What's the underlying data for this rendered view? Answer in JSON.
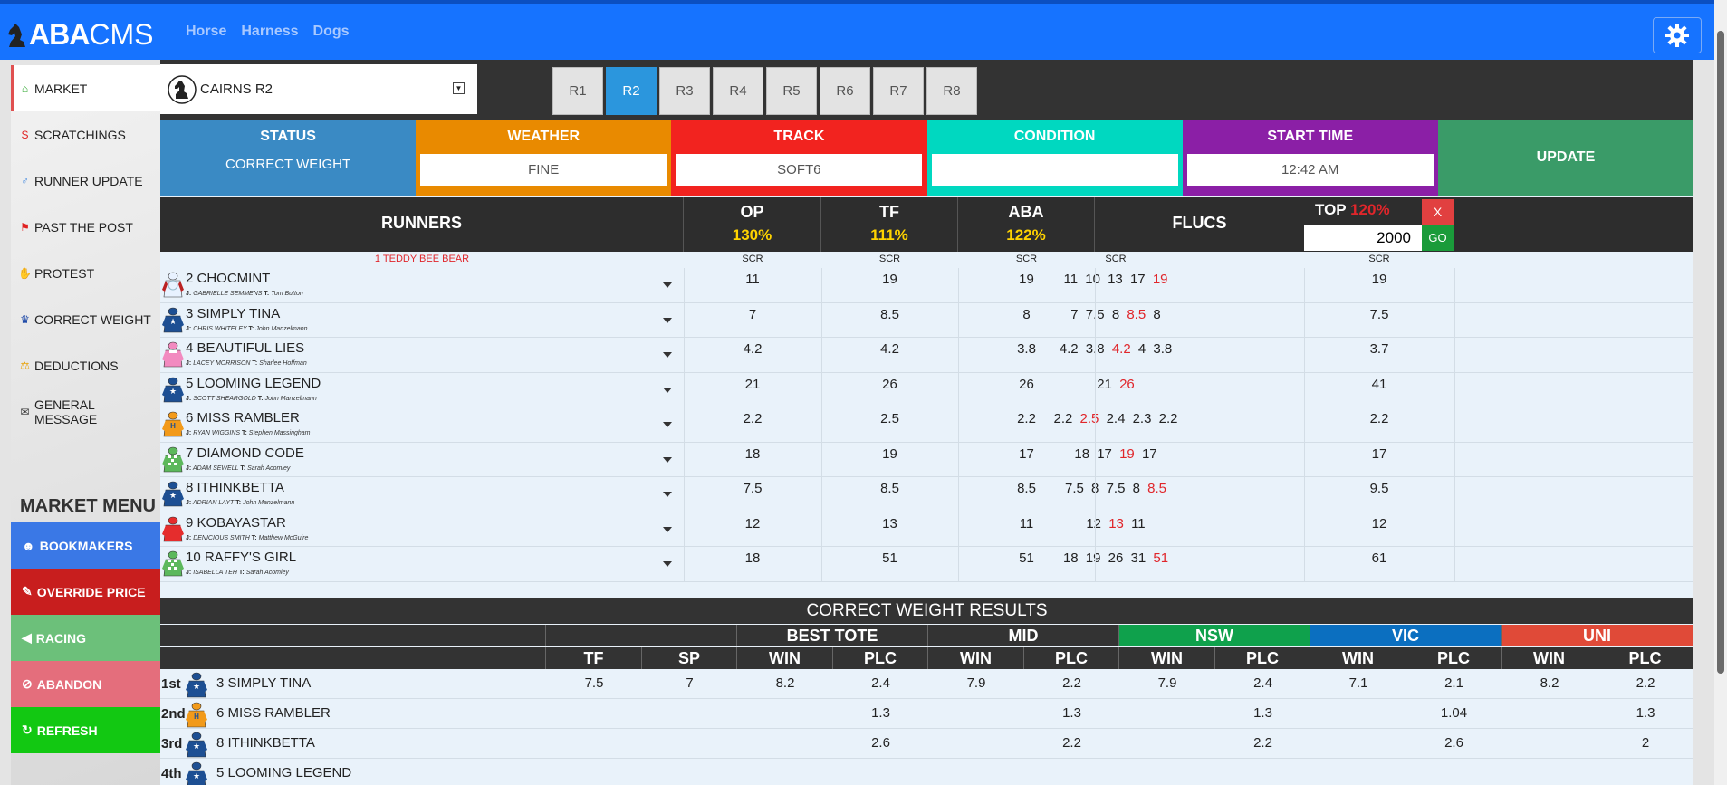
{
  "app": {
    "logo_aba": "ABA",
    "logo_cms": "CMS",
    "nav": [
      "Horse",
      "Harness",
      "Dogs"
    ]
  },
  "sidebar": {
    "items": [
      {
        "label": "MARKET",
        "icon": "bank-icon",
        "color": "#2aa52a"
      },
      {
        "label": "SCRATCHINGS",
        "icon": "strikethrough-icon",
        "color": "#e02020"
      },
      {
        "label": "RUNNER UPDATE",
        "icon": "male-icon",
        "color": "#4d8fe0"
      },
      {
        "label": "PAST THE POST",
        "icon": "flag-icon",
        "color": "#e02020"
      },
      {
        "label": "PROTEST",
        "icon": "hand-icon",
        "color": "#2b8fe0"
      },
      {
        "label": "CORRECT WEIGHT",
        "icon": "trophy-icon",
        "color": "#1f4aa8"
      },
      {
        "label": "DEDUCTIONS",
        "icon": "scale-icon",
        "color": "#e8a000"
      },
      {
        "label": "GENERAL MESSAGE",
        "icon": "envelope-icon",
        "color": "#333333"
      }
    ],
    "menu_title": "MARKET MENU",
    "menu_buttons": [
      {
        "label": "BOOKMAKERS",
        "icon": "users-icon",
        "color": "#3a78e6"
      },
      {
        "label": "OVERRIDE PRICE",
        "icon": "edit-icon",
        "color": "#c81e1e"
      },
      {
        "label": "RACING",
        "icon": "bullhorn-icon",
        "color": "#6cc07a"
      },
      {
        "label": "ABANDON",
        "icon": "ban-icon",
        "color": "#e46e7c"
      },
      {
        "label": "REFRESH",
        "icon": "refresh-icon",
        "color": "#12c812"
      }
    ]
  },
  "race": {
    "selected": "CAIRNS R2",
    "tabs": [
      "R1",
      "R2",
      "R3",
      "R4",
      "R5",
      "R6",
      "R7",
      "R8"
    ],
    "active_tab": "R2"
  },
  "info": {
    "status_label": "STATUS",
    "status_value": "CORRECT WEIGHT",
    "weather_label": "WEATHER",
    "weather_value": "FINE",
    "track_label": "TRACK",
    "track_value": "SOFT6",
    "condition_label": "CONDITION",
    "condition_value": "",
    "start_label": "START TIME",
    "start_value": "12:42 AM",
    "update_label": "UPDATE"
  },
  "colors": {
    "status": "#3a8ac4",
    "weather": "#e98a00",
    "track": "#f2231f",
    "condition": "#00d8c0",
    "start": "#8b1fa6",
    "update": "#3a9b68"
  },
  "runners_table": {
    "headers": {
      "runners": "RUNNERS",
      "op": "OP",
      "op_pct": "130%",
      "tf": "TF",
      "tf_pct": "111%",
      "aba": "ABA",
      "aba_pct": "122%",
      "flucs": "FLUCS",
      "top": "TOP",
      "top_pct": "120%",
      "top_input": "2000",
      "x": "X",
      "go": "GO"
    },
    "scratched": {
      "name": "1 TEDDY BEE BEAR",
      "op": "SCR",
      "tf": "SCR",
      "aba": "SCR",
      "flucs": "SCR",
      "top": "SCR"
    },
    "rows": [
      {
        "name": "2 CHOCMINT",
        "jockey": "GABRIELLE SEMMENS",
        "trainer": "Tom Button",
        "op": "11",
        "tf": "19",
        "aba": "19",
        "flucs": [
          [
            "11",
            0
          ],
          [
            "10",
            0
          ],
          [
            "13",
            0
          ],
          [
            "17",
            0
          ],
          [
            "19",
            1
          ]
        ],
        "top": "19",
        "silk": "a"
      },
      {
        "name": "3 SIMPLY TINA",
        "jockey": "CHRIS WHITELEY",
        "trainer": "John Manzelmann",
        "op": "7",
        "tf": "8.5",
        "aba": "8",
        "flucs": [
          [
            "7",
            0
          ],
          [
            "7.5",
            0
          ],
          [
            "8",
            0
          ],
          [
            "8.5",
            1
          ],
          [
            "8",
            0
          ]
        ],
        "top": "7.5",
        "silk": "b"
      },
      {
        "name": "4 BEAUTIFUL LIES",
        "jockey": "LACEY MORRISON",
        "trainer": "Sharlee Hoffman",
        "op": "4.2",
        "tf": "4.2",
        "aba": "3.8",
        "flucs": [
          [
            "4.2",
            0
          ],
          [
            "3.8",
            0
          ],
          [
            "4.2",
            1
          ],
          [
            "4",
            0
          ],
          [
            "3.8",
            0
          ]
        ],
        "top": "3.7",
        "silk": "c"
      },
      {
        "name": "5 LOOMING LEGEND",
        "jockey": "SCOTT SHEARGOLD",
        "trainer": "John Manzelmann",
        "op": "21",
        "tf": "26",
        "aba": "26",
        "flucs": [
          [
            "21",
            0
          ],
          [
            "26",
            1
          ]
        ],
        "top": "41",
        "silk": "b"
      },
      {
        "name": "6 MISS RAMBLER",
        "jockey": "RYAN WIGGINS",
        "trainer": "Stephen Massingham",
        "op": "2.2",
        "tf": "2.5",
        "aba": "2.2",
        "flucs": [
          [
            "2.2",
            0
          ],
          [
            "2.5",
            1
          ],
          [
            "2.4",
            0
          ],
          [
            "2.3",
            0
          ],
          [
            "2.2",
            0
          ]
        ],
        "top": "2.2",
        "silk": "d"
      },
      {
        "name": "7 DIAMOND CODE",
        "jockey": "ADAM SEWELL",
        "trainer": "Sarah Acomley",
        "op": "18",
        "tf": "19",
        "aba": "17",
        "flucs": [
          [
            "18",
            0
          ],
          [
            "17",
            0
          ],
          [
            "19",
            1
          ],
          [
            "17",
            0
          ]
        ],
        "top": "17",
        "silk": "e"
      },
      {
        "name": "8 ITHINKBETTA",
        "jockey": "ADRIAN LAYT",
        "trainer": "John Manzelmann",
        "op": "7.5",
        "tf": "8.5",
        "aba": "8.5",
        "flucs": [
          [
            "7.5",
            0
          ],
          [
            "8",
            0
          ],
          [
            "7.5",
            0
          ],
          [
            "8",
            0
          ],
          [
            "8.5",
            1
          ]
        ],
        "top": "9.5",
        "silk": "b"
      },
      {
        "name": "9 KOBAYASTAR",
        "jockey": "DENICIOUS SMITH",
        "trainer": "Matthew McGuire",
        "op": "12",
        "tf": "13",
        "aba": "11",
        "flucs": [
          [
            "12",
            0
          ],
          [
            "13",
            1
          ],
          [
            "11",
            0
          ]
        ],
        "top": "12",
        "silk": "f"
      },
      {
        "name": "10 RAFFY'S GIRL",
        "jockey": "ISABELLA TEH",
        "trainer": "Sarah Acomley",
        "op": "18",
        "tf": "51",
        "aba": "51",
        "flucs": [
          [
            "18",
            0
          ],
          [
            "19",
            0
          ],
          [
            "26",
            0
          ],
          [
            "31",
            0
          ],
          [
            "51",
            1
          ]
        ],
        "top": "61",
        "silk": "e"
      }
    ]
  },
  "correct_weight": {
    "title": "CORRECT WEIGHT RESULTS",
    "groups": {
      "best_tote": "BEST TOTE",
      "mid": "MID",
      "nsw": "NSW",
      "vic": "VIC",
      "uni": "UNI"
    },
    "sub": {
      "tf": "TF",
      "sp": "SP",
      "win": "WIN",
      "plc": "PLC"
    },
    "rows": [
      {
        "pos": "1st",
        "name": "3 SIMPLY TINA",
        "silk": "b",
        "tf": "7.5",
        "sp": "7",
        "bt_win": "8.2",
        "bt_plc": "2.4",
        "mid_win": "7.9",
        "mid_plc": "2.2",
        "nsw_win": "7.9",
        "nsw_plc": "2.4",
        "vic_win": "7.1",
        "vic_plc": "2.1",
        "uni_win": "8.2",
        "uni_plc": "2.2"
      },
      {
        "pos": "2nd",
        "name": "6 MISS RAMBLER",
        "silk": "d",
        "tf": "",
        "sp": "",
        "bt_win": "",
        "bt_plc": "1.3",
        "mid_win": "",
        "mid_plc": "1.3",
        "nsw_win": "",
        "nsw_plc": "1.3",
        "vic_win": "",
        "vic_plc": "1.04",
        "uni_win": "",
        "uni_plc": "1.3"
      },
      {
        "pos": "3rd",
        "name": "8 ITHINKBETTA",
        "silk": "b",
        "tf": "",
        "sp": "",
        "bt_win": "",
        "bt_plc": "2.6",
        "mid_win": "",
        "mid_plc": "2.2",
        "nsw_win": "",
        "nsw_plc": "2.2",
        "vic_win": "",
        "vic_plc": "2.6",
        "uni_win": "",
        "uni_plc": "2"
      },
      {
        "pos": "4th",
        "name": "5 LOOMING LEGEND",
        "silk": "b",
        "tf": "",
        "sp": "",
        "bt_win": "",
        "bt_plc": "",
        "mid_win": "",
        "mid_plc": "",
        "nsw_win": "",
        "nsw_plc": "",
        "vic_win": "",
        "vic_plc": "",
        "uni_win": "",
        "uni_plc": ""
      }
    ]
  }
}
